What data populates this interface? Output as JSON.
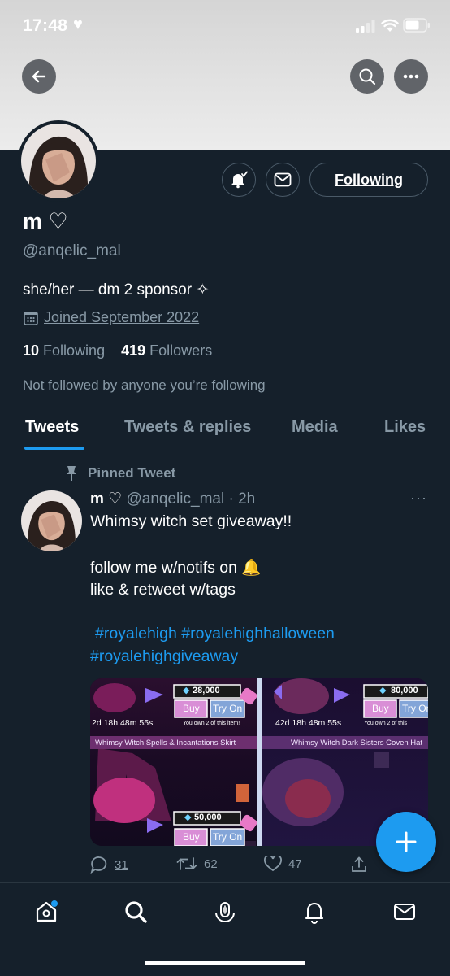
{
  "status_bar": {
    "time": "17:48",
    "time_icon": "heart-icon"
  },
  "header": {
    "back": "back-arrow-icon",
    "search": "search-icon",
    "more": "more-icon"
  },
  "profile": {
    "display_name": "m ♡",
    "handle": "@anqelic_mal",
    "bio": "she/her — dm 2 sponsor ✧",
    "joined": "Joined September 2022",
    "following_count": "10",
    "following_label": "Following",
    "followers_count": "419",
    "followers_label": "Followers",
    "not_followed": "Not followed by anyone you’re following",
    "following_button": "Following"
  },
  "tabs": [
    "Tweets",
    "Tweets & replies",
    "Media",
    "Likes"
  ],
  "tweet": {
    "pinned_label": "Pinned Tweet",
    "name": "m ♡",
    "handle_time": "@anqelic_mal · 2h",
    "lines": [
      "Whimsy witch set giveaway!!",
      "follow me w/notifs on 🔔",
      "like & retweet w/tags"
    ],
    "hashtags_line1": "#royalehigh #royalehighhalloween",
    "hashtags_line2": "#royalehighgiveaway",
    "media": {
      "items": [
        {
          "price": "28,000",
          "timer": "2d 18h 48m 55s",
          "owned": "You own 2 of this item!",
          "title": "Whimsy Witch Spells & Incantations Skirt"
        },
        {
          "price": "80,000",
          "timer": "42d 18h 48m 55s",
          "owned": "You own 2 of this",
          "title": "Whimsy Witch Dark Sisters Coven Hat"
        }
      ],
      "bottom_price": "50,000",
      "buy": "Buy",
      "try_on": "Try On"
    },
    "replies": "31",
    "retweets": "62",
    "likes": "47"
  },
  "colors": {
    "accent": "#1d9bf0",
    "background": "#15202b",
    "muted": "#8899a6"
  }
}
